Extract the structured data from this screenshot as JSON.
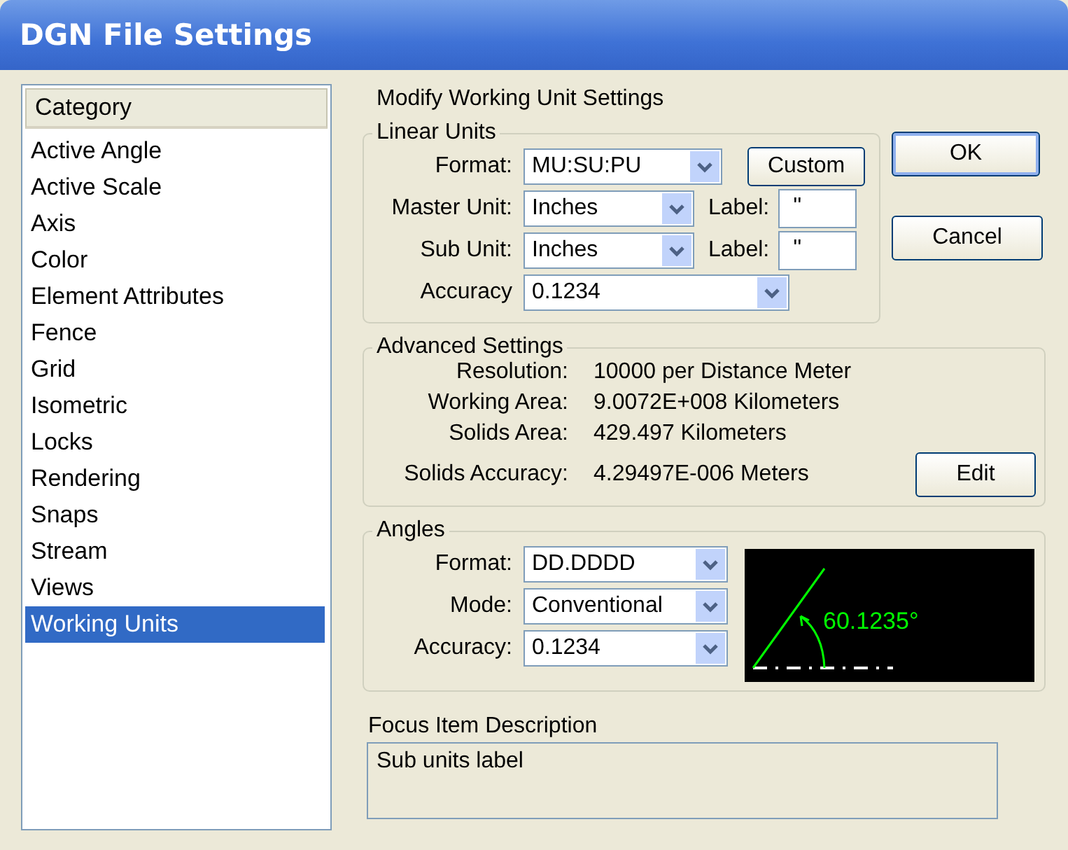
{
  "window": {
    "title": "DGN File Settings"
  },
  "category_list": {
    "header": "Category",
    "items": [
      {
        "label": "Active Angle",
        "selected": false
      },
      {
        "label": "Active Scale",
        "selected": false
      },
      {
        "label": "Axis",
        "selected": false
      },
      {
        "label": "Color",
        "selected": false
      },
      {
        "label": "Element Attributes",
        "selected": false
      },
      {
        "label": "Fence",
        "selected": false
      },
      {
        "label": "Grid",
        "selected": false
      },
      {
        "label": "Isometric",
        "selected": false
      },
      {
        "label": "Locks",
        "selected": false
      },
      {
        "label": "Rendering",
        "selected": false
      },
      {
        "label": "Snaps",
        "selected": false
      },
      {
        "label": "Stream",
        "selected": false
      },
      {
        "label": "Views",
        "selected": false
      },
      {
        "label": "Working Units",
        "selected": true
      }
    ]
  },
  "heading": "Modify Working Unit Settings",
  "linear_units": {
    "title": "Linear Units",
    "format": {
      "label": "Format:",
      "value": "MU:SU:PU"
    },
    "custom_button": "Custom",
    "units": [
      {
        "label": "Master Unit:",
        "value": "Inches",
        "caption": "Label:",
        "label_value": "''"
      },
      {
        "label": "Sub Unit:",
        "value": "Inches",
        "caption": "Label:",
        "label_value": "''"
      }
    ],
    "accuracy": {
      "label": "Accuracy",
      "value": "0.1234"
    }
  },
  "buttons": [
    "OK",
    "Cancel"
  ],
  "advanced_settings": {
    "title": "Advanced Settings",
    "rows": [
      {
        "label": "Resolution:",
        "value": "10000 per Distance Meter"
      },
      {
        "label": "Working Area:",
        "value": "9.0072E+008 Kilometers"
      },
      {
        "label": "Solids Area:",
        "value": "429.497 Kilometers"
      },
      {
        "label": "Solids Accuracy:",
        "value": "4.29497E-006 Meters"
      }
    ],
    "edit_button": "Edit"
  },
  "angles": {
    "title": "Angles",
    "rows": [
      {
        "label": "Format:",
        "value": "DD.DDDD"
      },
      {
        "label": "Mode:",
        "value": "Conventional"
      },
      {
        "label": "Accuracy:",
        "value": "0.1234"
      }
    ],
    "preview_reading": "60.1235°"
  },
  "focus_description": {
    "title": "Focus Item Description",
    "text": "Sub units label"
  }
}
